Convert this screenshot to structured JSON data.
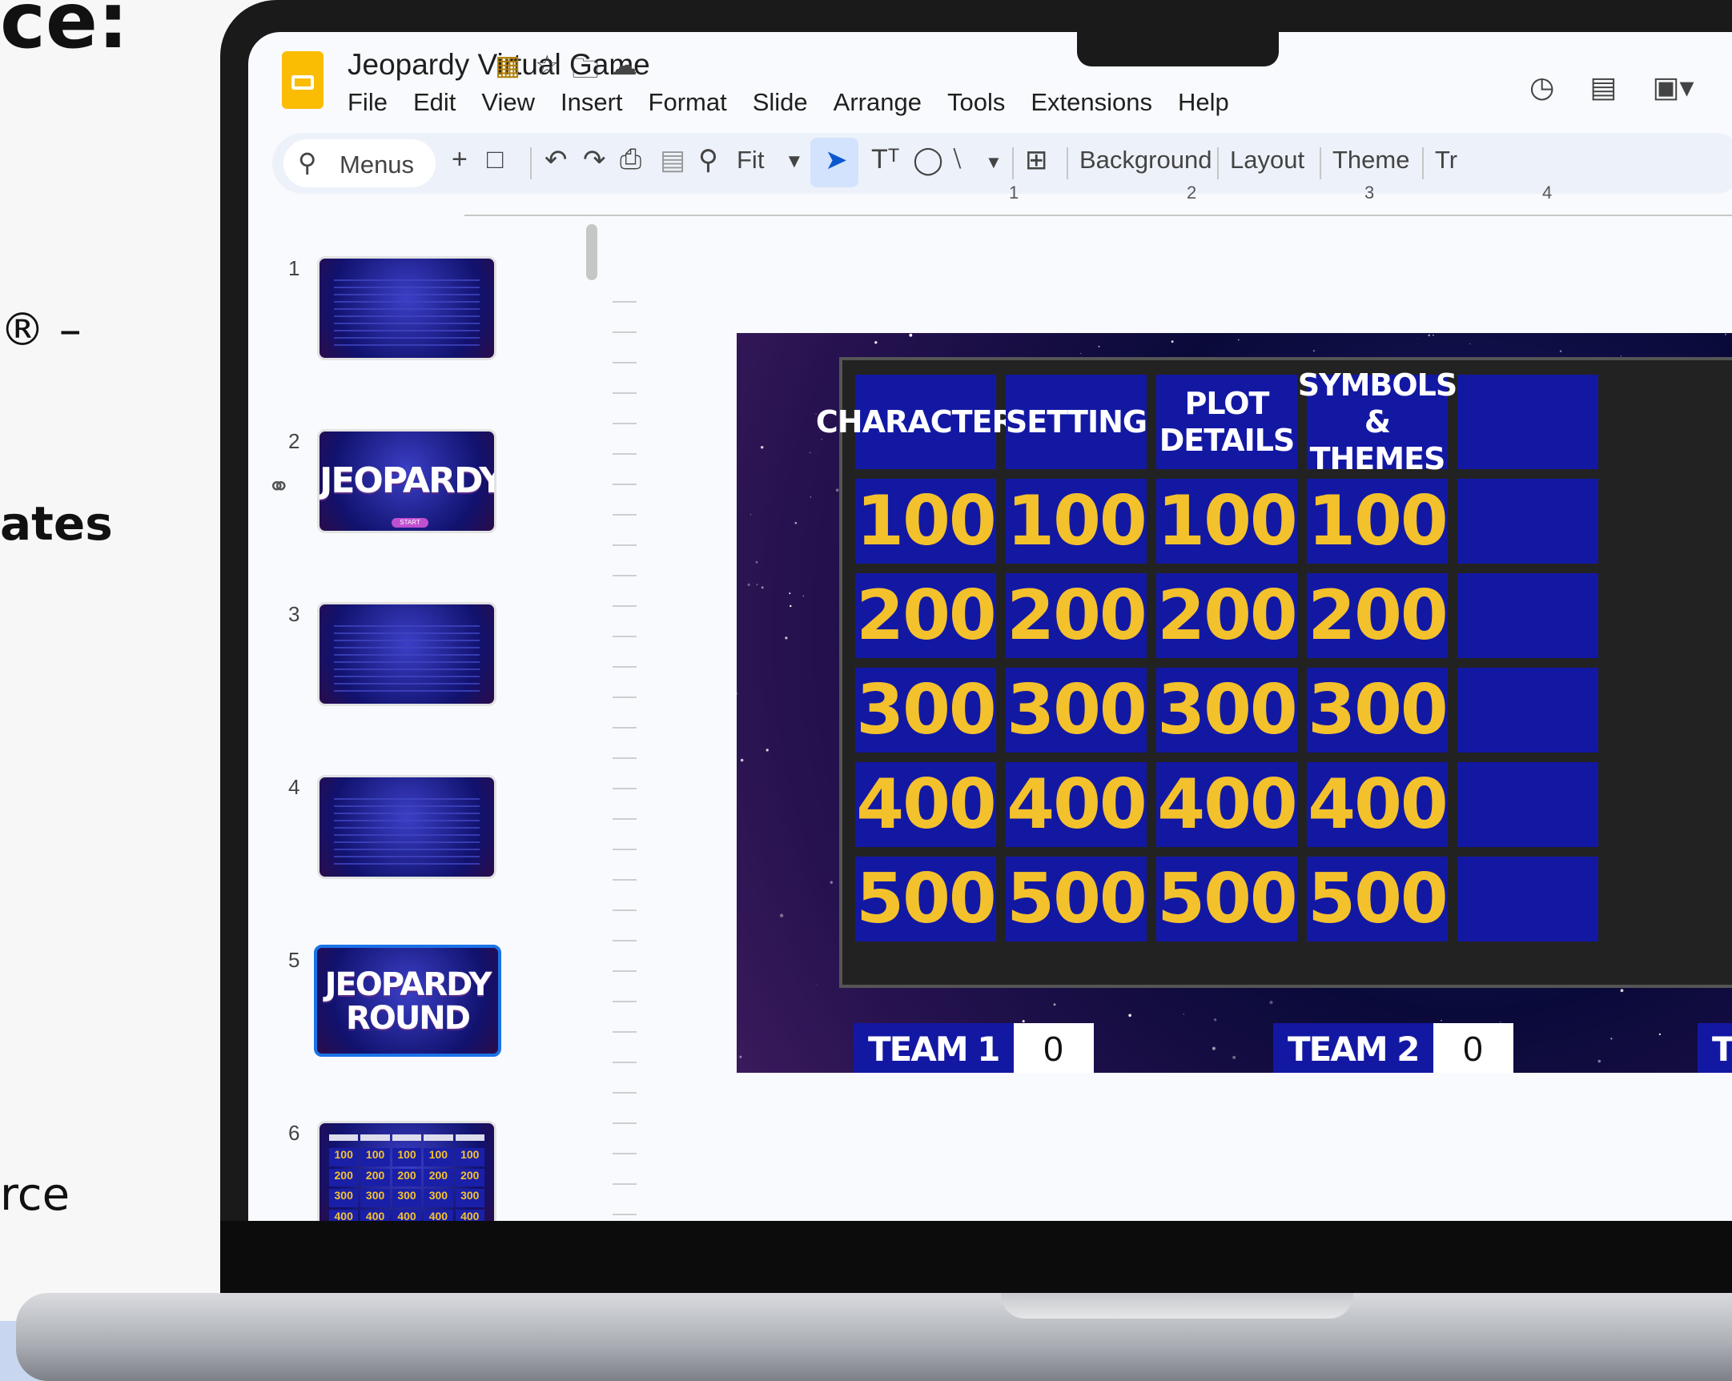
{
  "promo": {
    "top": "ce:",
    "dash": "® –",
    "bold": "ates",
    "bottom": "rce"
  },
  "app": {
    "doc_title": "Jeopardy Virtual Game",
    "menu": [
      "File",
      "Edit",
      "View",
      "Insert",
      "Format",
      "Slide",
      "Arrange",
      "Tools",
      "Extensions",
      "Help"
    ]
  },
  "toolbar": {
    "search_label": "Menus",
    "zoom_label": "Fit",
    "background_label": "Background",
    "layout_label": "Layout",
    "theme_label": "Theme",
    "transition_label": "Tr"
  },
  "ruler": {
    "labels": [
      "1",
      "2",
      "3",
      "4"
    ]
  },
  "filmstrip": {
    "numbers": [
      "1",
      "2",
      "3",
      "4",
      "5",
      "6"
    ],
    "slide2_title": "JEOPARDY!",
    "slide2_button": "START",
    "slide5_title_line1": "JEOPARDY",
    "slide5_title_line2": "ROUND",
    "slide6_values": [
      "100",
      "100",
      "100",
      "100",
      "100",
      "200",
      "200",
      "200",
      "200",
      "200",
      "300",
      "300",
      "300",
      "300",
      "300",
      "400",
      "400",
      "400",
      "400",
      "400"
    ]
  },
  "board": {
    "categories": [
      "CHARACTERS",
      "SETTING",
      "PLOT DETAILS",
      "SYMBOLS & THEMES"
    ],
    "values": [
      "100",
      "200",
      "300",
      "400",
      "500"
    ],
    "teams": [
      {
        "name": "TEAM 1",
        "score": "0"
      },
      {
        "name": "TEAM 2",
        "score": "0"
      },
      {
        "name": "TE",
        "score": ""
      }
    ]
  },
  "colors": {
    "cell_blue": "#1318a3",
    "value_gold": "#f3c12c",
    "accent_blue": "#1a73e8",
    "slides_yellow": "#fbbc04"
  }
}
